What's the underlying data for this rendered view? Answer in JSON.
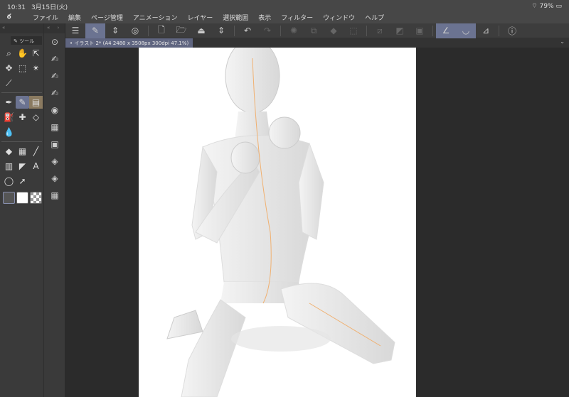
{
  "status": {
    "time": "10:31",
    "date": "3月15日(火)",
    "battery": "79%"
  },
  "menu": {
    "logo": "ఠ",
    "items": [
      "ファイル",
      "編集",
      "ページ管理",
      "アニメーション",
      "レイヤー",
      "選択範囲",
      "表示",
      "フィルター",
      "ウィンドウ",
      "ヘルプ"
    ]
  },
  "document": {
    "tab_label": "• イラスト 2* (A4 2480 x 3508px 300dpi 47.1%)"
  },
  "left_panel": {
    "collapse": "«",
    "tool_tab": "ツール"
  },
  "col2": {
    "collapse": "«",
    "expand": "›"
  },
  "accent_color": "#6b7391"
}
